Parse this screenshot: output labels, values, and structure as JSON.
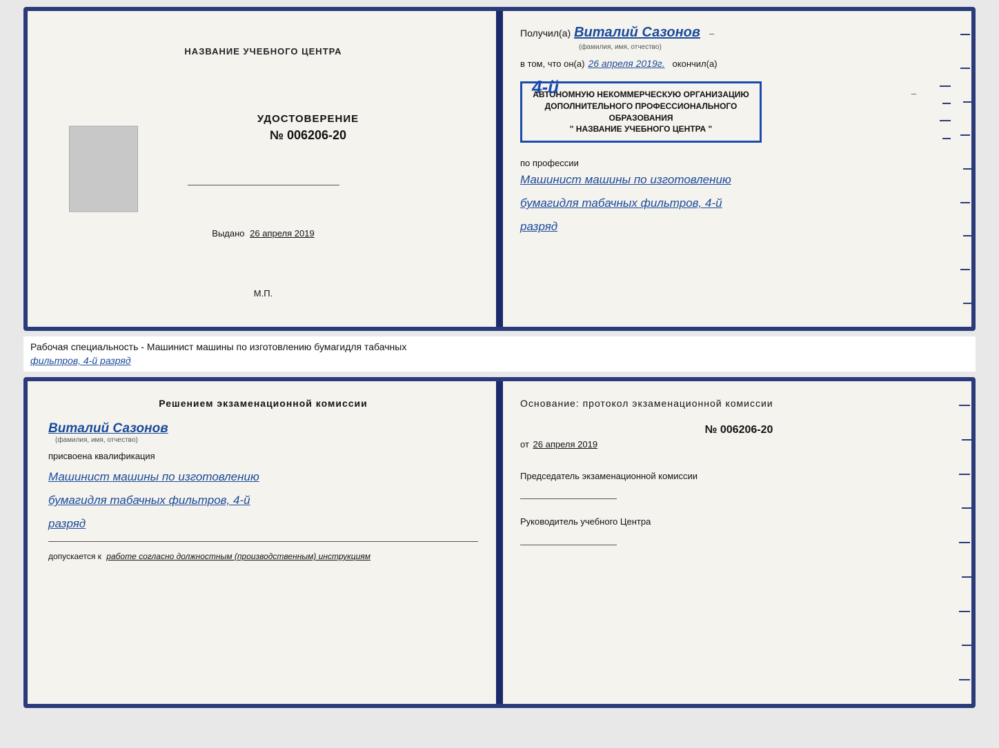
{
  "topDoc": {
    "leftPage": {
      "centerTitle": "НАЗВАНИЕ УЧЕБНОГО ЦЕНТРА",
      "certLabel": "УДОСТОВЕРЕНИЕ",
      "certNumber": "№ 006206-20",
      "issuedLabel": "Выдано",
      "issuedDate": "26 апреля 2019",
      "mpLabel": "М.П."
    },
    "rightPage": {
      "receivedLabel": "Получил(а)",
      "recipientName": "Виталий Сазонов",
      "recipientSubtext": "(фамилия, имя, отчество)",
      "tomLabel": "в том, что он(а)",
      "date": "26 апреля 2019г.",
      "finishedLabel": "окончил(а)",
      "stampNumber": "4-й",
      "stampLine1": "АВТОНОМНУЮ НЕКОММЕРЧЕСКУЮ ОРГАНИЗАЦИЮ",
      "stampLine2": "ДОПОЛНИТЕЛЬНОГО ПРОФЕССИОНАЛЬНОГО ОБРАЗОВАНИЯ",
      "stampLine3": "\" НАЗВАНИЕ УЧЕБНОГО ЦЕНТРА \"",
      "professionLabel": "по профессии",
      "professionLine1": "Машинист машины по изготовлению",
      "professionLine2": "бумагидля табачных фильтров, 4-й",
      "professionLine3": "разряд"
    }
  },
  "middleStrip": {
    "text1": "Рабочая специальность - Машинист машины по изготовлению бумагидля табачных",
    "text2": "фильтров, 4-й разряд"
  },
  "bottomDoc": {
    "leftPage": {
      "decisionTitle": "Решением экзаменационной комиссии",
      "recipientName": "Виталий Сазонов",
      "recipientSubtext": "(фамилия, имя, отчество)",
      "assignedLabel": "присвоена квалификация",
      "qualLine1": "Машинист машины по изготовлению",
      "qualLine2": "бумагидля табачных фильтров, 4-й",
      "qualLine3": "разряд",
      "admittedLabel": "допускается к",
      "admittedText": "работе согласно должностным (производственным) инструкциям"
    },
    "rightPage": {
      "basisLabel": "Основание: протокол экзаменационной комиссии",
      "protocolNumber": "№ 006206-20",
      "fromLabel": "от",
      "date": "26 апреля 2019",
      "chairmanLabel": "Председатель экзаменационной комиссии",
      "headLabel": "Руководитель учебного Центра"
    }
  }
}
